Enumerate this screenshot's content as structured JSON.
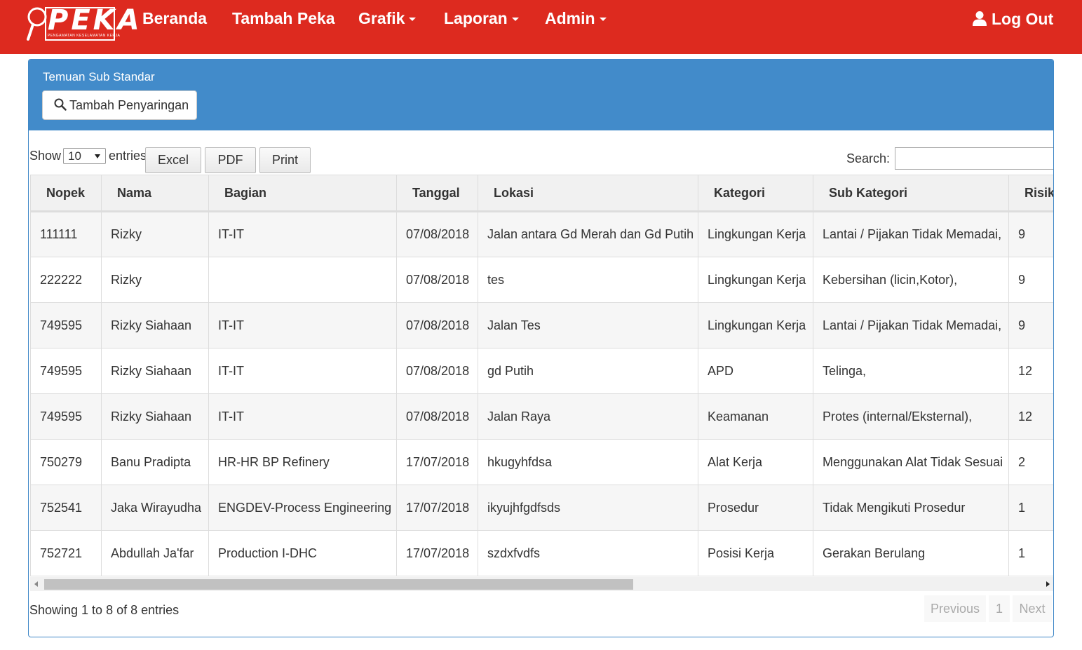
{
  "brand": {
    "logo_text": "PEKA",
    "logo_subtitle": "PENGAMATAN KESELAMATAN KERJA"
  },
  "nav": {
    "items": [
      {
        "label": "Beranda"
      },
      {
        "label": "Tambah Peka"
      },
      {
        "label": "Grafik"
      },
      {
        "label": "Laporan"
      },
      {
        "label": "Admin"
      }
    ],
    "logout": "Log Out"
  },
  "panel": {
    "title": "Temuan Sub Standar",
    "filter_button": "Tambah Penyaringan"
  },
  "controls": {
    "show_label": "Show",
    "page_length": "10",
    "entries_label": "entries",
    "buttons": [
      "Excel",
      "PDF",
      "Print"
    ],
    "search_label": "Search:",
    "search_value": ""
  },
  "table": {
    "columns": [
      "Nopek",
      "Nama",
      "Bagian",
      "Tanggal",
      "Lokasi",
      "Kategori",
      "Sub Kategori",
      "Risiko"
    ],
    "rows": [
      [
        "111111",
        "Rizky",
        "IT-IT",
        "07/08/2018",
        "Jalan antara Gd Merah dan Gd Putih",
        "Lingkungan Kerja",
        "Lantai / Pijakan Tidak Memadai,",
        "9"
      ],
      [
        "222222",
        "Rizky",
        "",
        "07/08/2018",
        "tes",
        "Lingkungan Kerja",
        "Kebersihan (licin,Kotor),",
        "9"
      ],
      [
        "749595",
        "Rizky Siahaan",
        "IT-IT",
        "07/08/2018",
        "Jalan Tes",
        "Lingkungan Kerja",
        "Lantai / Pijakan Tidak Memadai,",
        "9"
      ],
      [
        "749595",
        "Rizky Siahaan",
        "IT-IT",
        "07/08/2018",
        "gd Putih",
        "APD",
        "Telinga,",
        "12"
      ],
      [
        "749595",
        "Rizky Siahaan",
        "IT-IT",
        "07/08/2018",
        "Jalan Raya",
        "Keamanan",
        "Protes (internal/Eksternal),",
        "12"
      ],
      [
        "750279",
        "Banu Pradipta",
        "HR-HR BP Refinery",
        "17/07/2018",
        "hkugyhfdsa",
        "Alat Kerja",
        "Menggunakan Alat Tidak Sesuai",
        "2"
      ],
      [
        "752541",
        "Jaka Wirayudha",
        "ENGDEV-Process Engineering",
        "17/07/2018",
        "ikyujhfgdfsds",
        "Prosedur",
        "Tidak Mengikuti Prosedur",
        "1"
      ],
      [
        "752721",
        "Abdullah Ja'far",
        "Production I-DHC",
        "17/07/2018",
        "szdxfvdfs",
        "Posisi Kerja",
        "Gerakan Berulang",
        "1"
      ]
    ]
  },
  "footer": {
    "info": "Showing 1 to 8 of 8 entries",
    "previous": "Previous",
    "page": "1",
    "next": "Next"
  }
}
